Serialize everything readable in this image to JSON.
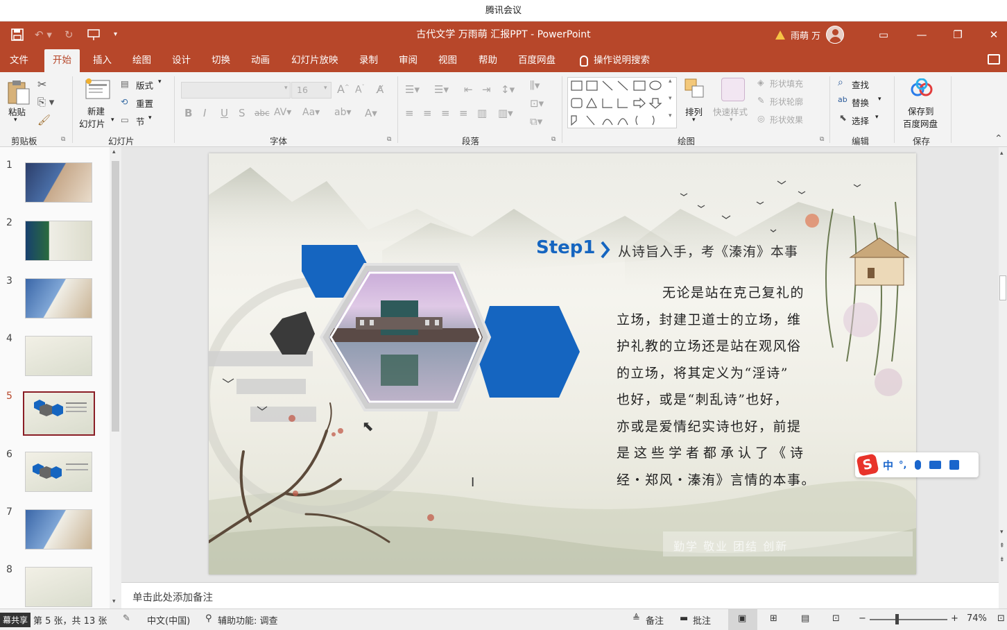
{
  "meeting": {
    "title": "腾讯会议"
  },
  "titlebar": {
    "doc_title": "古代文学 万雨萌 汇报PPT  -  PowerPoint",
    "user_name": "雨萌 万"
  },
  "tabs": [
    {
      "label": "文件"
    },
    {
      "label": "开始"
    },
    {
      "label": "插入"
    },
    {
      "label": "绘图"
    },
    {
      "label": "设计"
    },
    {
      "label": "切换"
    },
    {
      "label": "动画"
    },
    {
      "label": "幻灯片放映"
    },
    {
      "label": "录制"
    },
    {
      "label": "审阅"
    },
    {
      "label": "视图"
    },
    {
      "label": "帮助"
    },
    {
      "label": "百度网盘"
    }
  ],
  "tell_me": "操作说明搜索",
  "ribbon": {
    "clipboard": {
      "paste": "粘贴",
      "group": "剪贴板"
    },
    "slides": {
      "new_slide_1": "新建",
      "new_slide_2": "幻灯片",
      "layout": "版式",
      "reset": "重置",
      "section": "节",
      "group": "幻灯片"
    },
    "font": {
      "size": "16",
      "group": "字体"
    },
    "paragraph": {
      "group": "段落"
    },
    "drawing": {
      "arrange": "排列",
      "quick_styles": "快速样式",
      "shape_fill": "形状填充",
      "shape_outline": "形状轮廓",
      "shape_effects": "形状效果",
      "group": "绘图"
    },
    "editing": {
      "find": "查找",
      "replace": "替换",
      "select": "选择",
      "group": "编辑"
    },
    "save": {
      "label_1": "保存到",
      "label_2": "百度网盘",
      "group": "保存"
    }
  },
  "thumbnails": [
    {
      "num": "1"
    },
    {
      "num": "2"
    },
    {
      "num": "3"
    },
    {
      "num": "4"
    },
    {
      "num": "5"
    },
    {
      "num": "6"
    },
    {
      "num": "7"
    },
    {
      "num": "8"
    }
  ],
  "slide": {
    "step": "Step1",
    "heading": "从诗旨入手，考《溱洧》本事",
    "body_lines": [
      "无论是站在克己复礼的",
      "立场，封建卫道士的立场，维",
      "护礼教的立场还是站在观风俗",
      "的立场，将其定义为“淫诗”",
      "也好，或是“刺乱诗”也好，",
      "亦或是爱情纪实诗也好，前提",
      "是这些学者都承认了《诗",
      "经・郑风・溱洧》言情的本事。"
    ],
    "motto": "勤学  敬业  团结  创新",
    "hex_blue": "#1565c0",
    "hex_dark": "#3a3a3a"
  },
  "notes": {
    "placeholder": "单击此处添加备注"
  },
  "status": {
    "share_tag": "幕共享",
    "slide_info": "第 5 张，共 13 张",
    "language": "中文(中国)",
    "accessibility": "辅助功能: 调查",
    "notes_btn": "备注",
    "comments_btn": "批注",
    "zoom": "74%"
  },
  "ime": {
    "label": "中"
  }
}
